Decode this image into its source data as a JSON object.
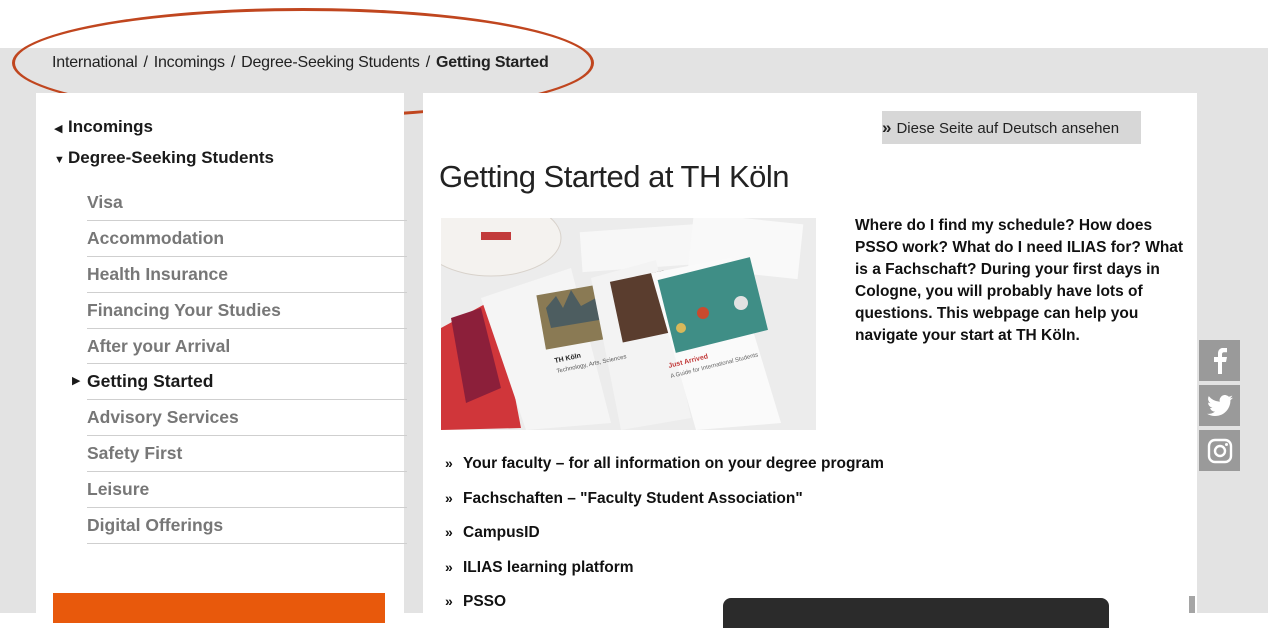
{
  "breadcrumb": {
    "items": [
      "International",
      "Incomings",
      "Degree-Seeking Students"
    ],
    "separator": "/",
    "current": "Getting Started"
  },
  "sidebar": {
    "parent_label": "Incomings",
    "section_label": "Degree-Seeking Students",
    "items": [
      {
        "label": "Visa",
        "active": false
      },
      {
        "label": "Accommodation",
        "active": false
      },
      {
        "label": "Health Insurance",
        "active": false
      },
      {
        "label": "Financing Your Studies",
        "active": false
      },
      {
        "label": "After your Arrival",
        "active": false
      },
      {
        "label": "Getting Started",
        "active": true
      },
      {
        "label": "Advisory Services",
        "active": false
      },
      {
        "label": "Safety First",
        "active": false
      },
      {
        "label": "Leisure",
        "active": false
      },
      {
        "label": "Digital Offerings",
        "active": false
      }
    ]
  },
  "main": {
    "language_link": "Diese Seite auf Deutsch ansehen",
    "title": "Getting Started at TH Köln",
    "intro": "Where do I find my schedule? How does PSSO work? What do I need ILIAS for? What is a Fachschaft? During your first days in Cologne, you will probably have lots of questions. This webpage can help you navigate your start at TH Köln.",
    "image_texts": {
      "card_title": "TH Köln",
      "card_sub": "Technology, Arts, Sciences",
      "card2_title": "Just Arrived",
      "card2_sub": "A Guide for International Students"
    },
    "links": [
      "Your faculty – for all information on your degree program",
      "Fachschaften – \"Faculty Student Association\"",
      "CampusID",
      "ILIAS learning platform",
      "PSSO"
    ]
  },
  "social": [
    "facebook-icon",
    "twitter-icon",
    "instagram-icon"
  ],
  "colors": {
    "accent_orange": "#e8590c",
    "highlight_oval": "#c0461f",
    "page_background": "#e3e3e3",
    "social_gray": "#9a9a9a"
  }
}
